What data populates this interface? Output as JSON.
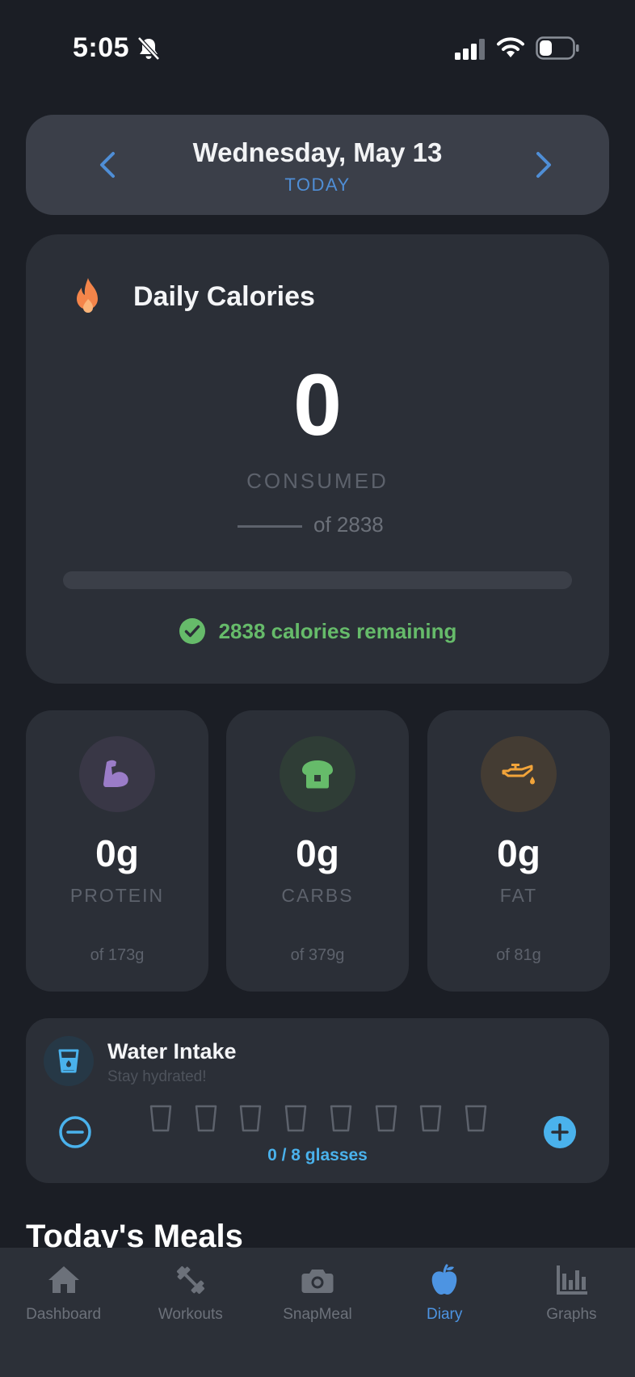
{
  "status_bar": {
    "time": "5:05",
    "icons": [
      "bell-slash-icon",
      "signal-icon",
      "wifi-icon",
      "battery-icon"
    ]
  },
  "date_header": {
    "date": "Wednesday, May 13",
    "relative": "TODAY",
    "prev_icon": "chevron-left-icon",
    "next_icon": "chevron-right-icon"
  },
  "calories": {
    "title": "Daily Calories",
    "icon": "flame-icon",
    "consumed": "0",
    "consumed_label": "CONSUMED",
    "goal_text": "of 2838",
    "progress": 0,
    "remaining_text": "2838 calories remaining",
    "accent": "#66bb6a"
  },
  "macros": {
    "protein": {
      "icon": "muscle-icon",
      "value": "0g",
      "label": "PROTEIN",
      "goal": "of 173g",
      "color": "#9b7cc8"
    },
    "carbs": {
      "icon": "bread-icon",
      "value": "0g",
      "label": "CARBS",
      "goal": "of 379g",
      "color": "#66bb6a"
    },
    "fat": {
      "icon": "oil-can-icon",
      "value": "0g",
      "label": "FAT",
      "goal": "of 81g",
      "color": "#f2a43a"
    }
  },
  "water": {
    "title": "Water Intake",
    "subtitle": "Stay hydrated!",
    "icon": "water-glass-icon",
    "count_text": "0 / 8 glasses",
    "glasses_filled": 0,
    "glasses_total": 8,
    "accent": "#4ab2ec"
  },
  "meals": {
    "heading": "Today's Meals"
  },
  "tabs": [
    {
      "label": "Dashboard",
      "icon": "home-icon",
      "active": false
    },
    {
      "label": "Workouts",
      "icon": "dumbbell-icon",
      "active": false
    },
    {
      "label": "SnapMeal",
      "icon": "camera-icon",
      "active": false
    },
    {
      "label": "Diary",
      "icon": "apple-icon",
      "active": true
    },
    {
      "label": "Graphs",
      "icon": "bar-chart-icon",
      "active": false
    }
  ]
}
